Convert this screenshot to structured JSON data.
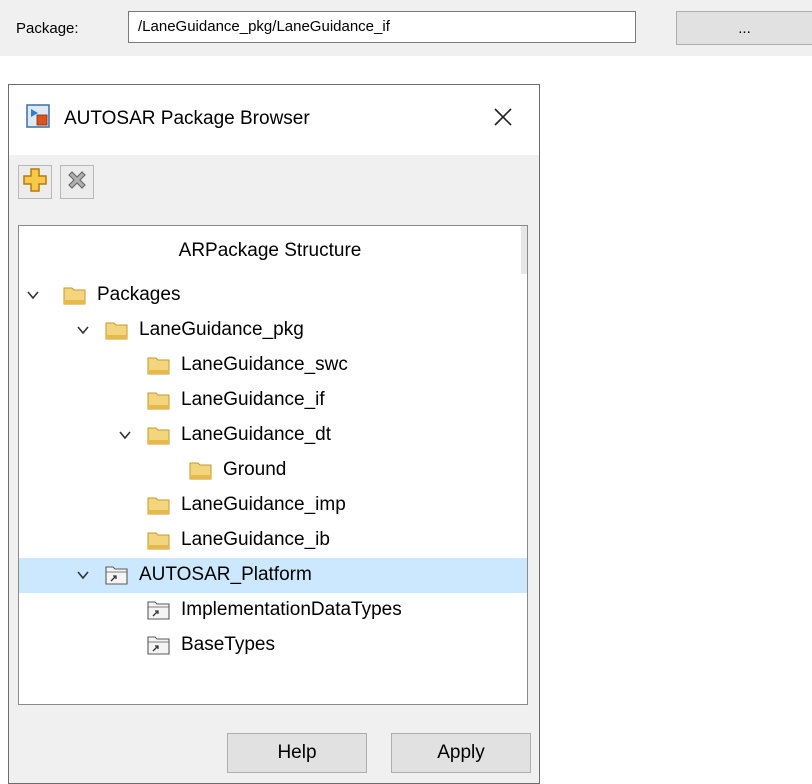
{
  "package_row": {
    "label": "Package:",
    "value": "/LaneGuidance_pkg/LaneGuidance_if",
    "browse_label": "..."
  },
  "dialog": {
    "title": "AUTOSAR Package Browser",
    "close_glyph": "✕",
    "toolbar": {
      "add_icon": "add-package-icon",
      "delete_icon": "delete-package-icon"
    },
    "tree": {
      "header": "ARPackage Structure",
      "nodes": [
        {
          "label": "Packages",
          "level": 0,
          "expanded": true,
          "icon": "folder-icon"
        },
        {
          "label": "LaneGuidance_pkg",
          "level": 1,
          "expanded": true,
          "icon": "folder-icon"
        },
        {
          "label": "LaneGuidance_swc",
          "level": 2,
          "expanded": null,
          "icon": "folder-icon"
        },
        {
          "label": "LaneGuidance_if",
          "level": 2,
          "expanded": null,
          "icon": "folder-icon"
        },
        {
          "label": "LaneGuidance_dt",
          "level": 2,
          "expanded": true,
          "icon": "folder-icon"
        },
        {
          "label": "Ground",
          "level": 3,
          "expanded": null,
          "icon": "folder-icon"
        },
        {
          "label": "LaneGuidance_imp",
          "level": 2,
          "expanded": null,
          "icon": "folder-icon"
        },
        {
          "label": "LaneGuidance_ib",
          "level": 2,
          "expanded": null,
          "icon": "folder-icon"
        },
        {
          "label": "AUTOSAR_Platform",
          "level": 1,
          "expanded": true,
          "icon": "linked-package-icon",
          "selected": true
        },
        {
          "label": "ImplementationDataTypes",
          "level": 2,
          "expanded": null,
          "icon": "linked-package-icon"
        },
        {
          "label": "BaseTypes",
          "level": 2,
          "expanded": null,
          "icon": "linked-package-icon"
        }
      ]
    },
    "buttons": {
      "help": "Help",
      "apply": "Apply"
    }
  },
  "colors": {
    "selection": "#cce8ff",
    "folder": "#e8c35a",
    "add_icon": "#f5b82e"
  }
}
